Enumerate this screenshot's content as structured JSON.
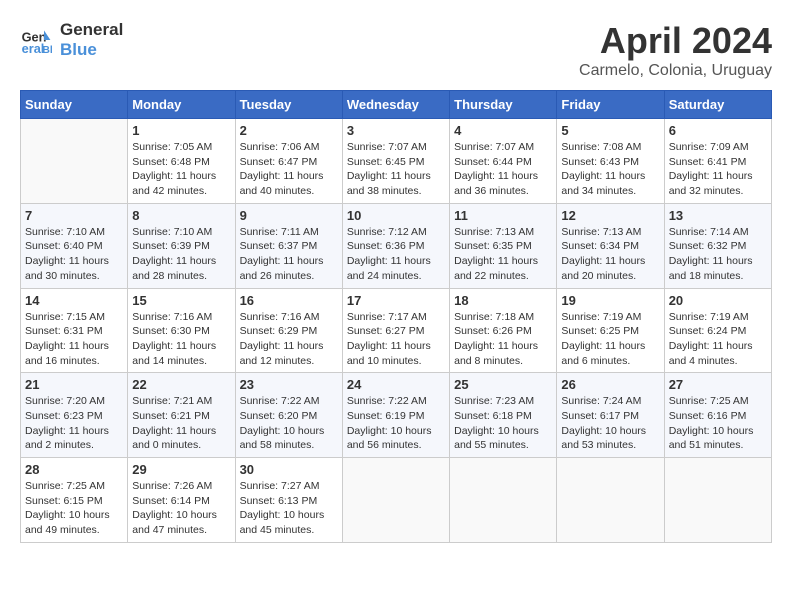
{
  "header": {
    "logo_line1": "General",
    "logo_line2": "Blue",
    "month_title": "April 2024",
    "subtitle": "Carmelo, Colonia, Uruguay"
  },
  "weekdays": [
    "Sunday",
    "Monday",
    "Tuesday",
    "Wednesday",
    "Thursday",
    "Friday",
    "Saturday"
  ],
  "weeks": [
    [
      {
        "day": "",
        "info": ""
      },
      {
        "day": "1",
        "info": "Sunrise: 7:05 AM\nSunset: 6:48 PM\nDaylight: 11 hours\nand 42 minutes."
      },
      {
        "day": "2",
        "info": "Sunrise: 7:06 AM\nSunset: 6:47 PM\nDaylight: 11 hours\nand 40 minutes."
      },
      {
        "day": "3",
        "info": "Sunrise: 7:07 AM\nSunset: 6:45 PM\nDaylight: 11 hours\nand 38 minutes."
      },
      {
        "day": "4",
        "info": "Sunrise: 7:07 AM\nSunset: 6:44 PM\nDaylight: 11 hours\nand 36 minutes."
      },
      {
        "day": "5",
        "info": "Sunrise: 7:08 AM\nSunset: 6:43 PM\nDaylight: 11 hours\nand 34 minutes."
      },
      {
        "day": "6",
        "info": "Sunrise: 7:09 AM\nSunset: 6:41 PM\nDaylight: 11 hours\nand 32 minutes."
      }
    ],
    [
      {
        "day": "7",
        "info": "Sunrise: 7:10 AM\nSunset: 6:40 PM\nDaylight: 11 hours\nand 30 minutes."
      },
      {
        "day": "8",
        "info": "Sunrise: 7:10 AM\nSunset: 6:39 PM\nDaylight: 11 hours\nand 28 minutes."
      },
      {
        "day": "9",
        "info": "Sunrise: 7:11 AM\nSunset: 6:37 PM\nDaylight: 11 hours\nand 26 minutes."
      },
      {
        "day": "10",
        "info": "Sunrise: 7:12 AM\nSunset: 6:36 PM\nDaylight: 11 hours\nand 24 minutes."
      },
      {
        "day": "11",
        "info": "Sunrise: 7:13 AM\nSunset: 6:35 PM\nDaylight: 11 hours\nand 22 minutes."
      },
      {
        "day": "12",
        "info": "Sunrise: 7:13 AM\nSunset: 6:34 PM\nDaylight: 11 hours\nand 20 minutes."
      },
      {
        "day": "13",
        "info": "Sunrise: 7:14 AM\nSunset: 6:32 PM\nDaylight: 11 hours\nand 18 minutes."
      }
    ],
    [
      {
        "day": "14",
        "info": "Sunrise: 7:15 AM\nSunset: 6:31 PM\nDaylight: 11 hours\nand 16 minutes."
      },
      {
        "day": "15",
        "info": "Sunrise: 7:16 AM\nSunset: 6:30 PM\nDaylight: 11 hours\nand 14 minutes."
      },
      {
        "day": "16",
        "info": "Sunrise: 7:16 AM\nSunset: 6:29 PM\nDaylight: 11 hours\nand 12 minutes."
      },
      {
        "day": "17",
        "info": "Sunrise: 7:17 AM\nSunset: 6:27 PM\nDaylight: 11 hours\nand 10 minutes."
      },
      {
        "day": "18",
        "info": "Sunrise: 7:18 AM\nSunset: 6:26 PM\nDaylight: 11 hours\nand 8 minutes."
      },
      {
        "day": "19",
        "info": "Sunrise: 7:19 AM\nSunset: 6:25 PM\nDaylight: 11 hours\nand 6 minutes."
      },
      {
        "day": "20",
        "info": "Sunrise: 7:19 AM\nSunset: 6:24 PM\nDaylight: 11 hours\nand 4 minutes."
      }
    ],
    [
      {
        "day": "21",
        "info": "Sunrise: 7:20 AM\nSunset: 6:23 PM\nDaylight: 11 hours\nand 2 minutes."
      },
      {
        "day": "22",
        "info": "Sunrise: 7:21 AM\nSunset: 6:21 PM\nDaylight: 11 hours\nand 0 minutes."
      },
      {
        "day": "23",
        "info": "Sunrise: 7:22 AM\nSunset: 6:20 PM\nDaylight: 10 hours\nand 58 minutes."
      },
      {
        "day": "24",
        "info": "Sunrise: 7:22 AM\nSunset: 6:19 PM\nDaylight: 10 hours\nand 56 minutes."
      },
      {
        "day": "25",
        "info": "Sunrise: 7:23 AM\nSunset: 6:18 PM\nDaylight: 10 hours\nand 55 minutes."
      },
      {
        "day": "26",
        "info": "Sunrise: 7:24 AM\nSunset: 6:17 PM\nDaylight: 10 hours\nand 53 minutes."
      },
      {
        "day": "27",
        "info": "Sunrise: 7:25 AM\nSunset: 6:16 PM\nDaylight: 10 hours\nand 51 minutes."
      }
    ],
    [
      {
        "day": "28",
        "info": "Sunrise: 7:25 AM\nSunset: 6:15 PM\nDaylight: 10 hours\nand 49 minutes."
      },
      {
        "day": "29",
        "info": "Sunrise: 7:26 AM\nSunset: 6:14 PM\nDaylight: 10 hours\nand 47 minutes."
      },
      {
        "day": "30",
        "info": "Sunrise: 7:27 AM\nSunset: 6:13 PM\nDaylight: 10 hours\nand 45 minutes."
      },
      {
        "day": "",
        "info": ""
      },
      {
        "day": "",
        "info": ""
      },
      {
        "day": "",
        "info": ""
      },
      {
        "day": "",
        "info": ""
      }
    ]
  ]
}
